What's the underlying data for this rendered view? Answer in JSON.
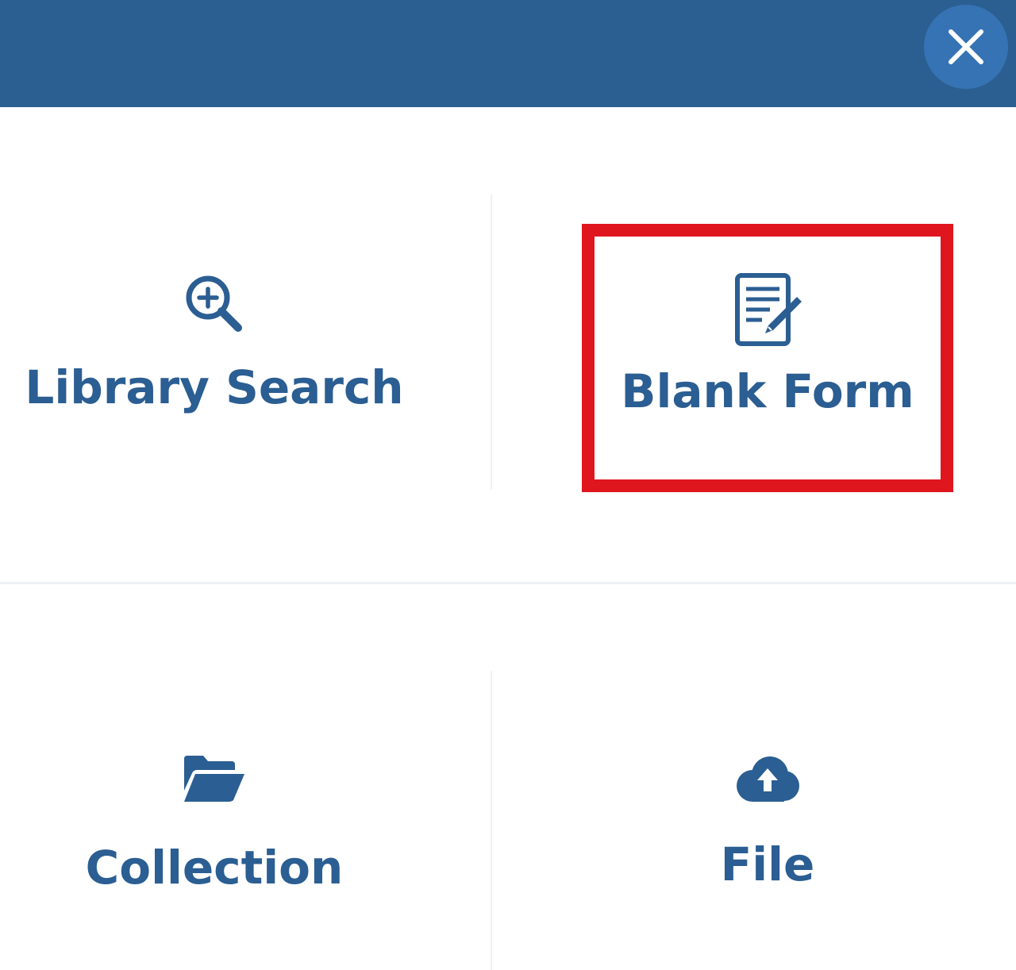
{
  "header": {
    "background_color": "#2b5f91",
    "close_icon": "close-icon",
    "close_label": "Close"
  },
  "options": [
    {
      "id": "library-search",
      "label": "Library Search",
      "icon": "search-plus-icon"
    },
    {
      "id": "blank-form",
      "label": "Blank Form",
      "icon": "form-edit-icon",
      "highlighted": true
    },
    {
      "id": "collection",
      "label": "Collection",
      "icon": "folder-open-icon"
    },
    {
      "id": "file",
      "label": "File",
      "icon": "cloud-upload-icon"
    }
  ],
  "colors": {
    "accent": "#2b5e92",
    "highlight": "#e0161f"
  }
}
